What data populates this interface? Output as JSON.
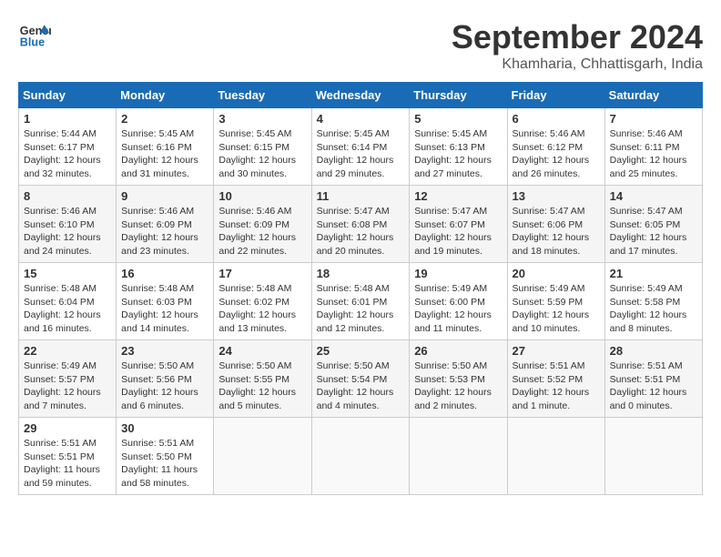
{
  "header": {
    "logo_line1": "General",
    "logo_line2": "Blue",
    "month": "September 2024",
    "location": "Khamharia, Chhattisgarh, India"
  },
  "weekdays": [
    "Sunday",
    "Monday",
    "Tuesday",
    "Wednesday",
    "Thursday",
    "Friday",
    "Saturday"
  ],
  "weeks": [
    [
      {
        "day": "1",
        "sunrise": "5:44 AM",
        "sunset": "6:17 PM",
        "daylight": "12 hours and 32 minutes."
      },
      {
        "day": "2",
        "sunrise": "5:45 AM",
        "sunset": "6:16 PM",
        "daylight": "12 hours and 31 minutes."
      },
      {
        "day": "3",
        "sunrise": "5:45 AM",
        "sunset": "6:15 PM",
        "daylight": "12 hours and 30 minutes."
      },
      {
        "day": "4",
        "sunrise": "5:45 AM",
        "sunset": "6:14 PM",
        "daylight": "12 hours and 29 minutes."
      },
      {
        "day": "5",
        "sunrise": "5:45 AM",
        "sunset": "6:13 PM",
        "daylight": "12 hours and 27 minutes."
      },
      {
        "day": "6",
        "sunrise": "5:46 AM",
        "sunset": "6:12 PM",
        "daylight": "12 hours and 26 minutes."
      },
      {
        "day": "7",
        "sunrise": "5:46 AM",
        "sunset": "6:11 PM",
        "daylight": "12 hours and 25 minutes."
      }
    ],
    [
      {
        "day": "8",
        "sunrise": "5:46 AM",
        "sunset": "6:10 PM",
        "daylight": "12 hours and 24 minutes."
      },
      {
        "day": "9",
        "sunrise": "5:46 AM",
        "sunset": "6:09 PM",
        "daylight": "12 hours and 23 minutes."
      },
      {
        "day": "10",
        "sunrise": "5:46 AM",
        "sunset": "6:09 PM",
        "daylight": "12 hours and 22 minutes."
      },
      {
        "day": "11",
        "sunrise": "5:47 AM",
        "sunset": "6:08 PM",
        "daylight": "12 hours and 20 minutes."
      },
      {
        "day": "12",
        "sunrise": "5:47 AM",
        "sunset": "6:07 PM",
        "daylight": "12 hours and 19 minutes."
      },
      {
        "day": "13",
        "sunrise": "5:47 AM",
        "sunset": "6:06 PM",
        "daylight": "12 hours and 18 minutes."
      },
      {
        "day": "14",
        "sunrise": "5:47 AM",
        "sunset": "6:05 PM",
        "daylight": "12 hours and 17 minutes."
      }
    ],
    [
      {
        "day": "15",
        "sunrise": "5:48 AM",
        "sunset": "6:04 PM",
        "daylight": "12 hours and 16 minutes."
      },
      {
        "day": "16",
        "sunrise": "5:48 AM",
        "sunset": "6:03 PM",
        "daylight": "12 hours and 14 minutes."
      },
      {
        "day": "17",
        "sunrise": "5:48 AM",
        "sunset": "6:02 PM",
        "daylight": "12 hours and 13 minutes."
      },
      {
        "day": "18",
        "sunrise": "5:48 AM",
        "sunset": "6:01 PM",
        "daylight": "12 hours and 12 minutes."
      },
      {
        "day": "19",
        "sunrise": "5:49 AM",
        "sunset": "6:00 PM",
        "daylight": "12 hours and 11 minutes."
      },
      {
        "day": "20",
        "sunrise": "5:49 AM",
        "sunset": "5:59 PM",
        "daylight": "12 hours and 10 minutes."
      },
      {
        "day": "21",
        "sunrise": "5:49 AM",
        "sunset": "5:58 PM",
        "daylight": "12 hours and 8 minutes."
      }
    ],
    [
      {
        "day": "22",
        "sunrise": "5:49 AM",
        "sunset": "5:57 PM",
        "daylight": "12 hours and 7 minutes."
      },
      {
        "day": "23",
        "sunrise": "5:50 AM",
        "sunset": "5:56 PM",
        "daylight": "12 hours and 6 minutes."
      },
      {
        "day": "24",
        "sunrise": "5:50 AM",
        "sunset": "5:55 PM",
        "daylight": "12 hours and 5 minutes."
      },
      {
        "day": "25",
        "sunrise": "5:50 AM",
        "sunset": "5:54 PM",
        "daylight": "12 hours and 4 minutes."
      },
      {
        "day": "26",
        "sunrise": "5:50 AM",
        "sunset": "5:53 PM",
        "daylight": "12 hours and 2 minutes."
      },
      {
        "day": "27",
        "sunrise": "5:51 AM",
        "sunset": "5:52 PM",
        "daylight": "12 hours and 1 minute."
      },
      {
        "day": "28",
        "sunrise": "5:51 AM",
        "sunset": "5:51 PM",
        "daylight": "12 hours and 0 minutes."
      }
    ],
    [
      {
        "day": "29",
        "sunrise": "5:51 AM",
        "sunset": "5:51 PM",
        "daylight": "11 hours and 59 minutes."
      },
      {
        "day": "30",
        "sunrise": "5:51 AM",
        "sunset": "5:50 PM",
        "daylight": "11 hours and 58 minutes."
      },
      null,
      null,
      null,
      null,
      null
    ]
  ]
}
